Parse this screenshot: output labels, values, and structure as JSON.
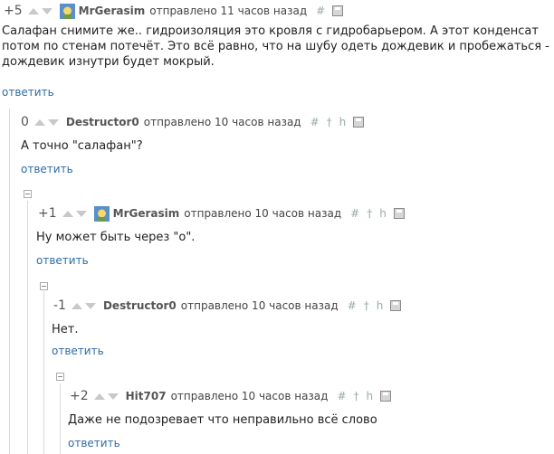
{
  "icons": {
    "hash": "#",
    "pin": "†",
    "tree": "h"
  },
  "comments": [
    {
      "rating": "+5",
      "author": "MrGerasim",
      "meta": "отправлено 11 часов назад",
      "text": "Салафан снимите же.. гидроизоляция это кровля с гидробарьером. А этот конденсат потом по стенам потечёт. Это всё равно, что на шубу одеть дождевик и пробежаться - дождевик изнутри будет мокрый.",
      "reply": "ответить"
    },
    {
      "rating": "0",
      "author": "Destructor0",
      "meta": "отправлено 10 часов назад",
      "text": "А точно \"салафан\"?",
      "reply": "ответить"
    },
    {
      "rating": "+1",
      "author": "MrGerasim",
      "meta": "отправлено 10 часов назад",
      "text": "Ну может быть через \"о\".",
      "reply": "ответить"
    },
    {
      "rating": "-1",
      "author": "Destructor0",
      "meta": "отправлено 10 часов назад",
      "text": "Нет.",
      "reply": "ответить"
    },
    {
      "rating": "+2",
      "author": "Hit707",
      "meta": "отправлено 10 часов назад",
      "text": "Даже не подозревает что неправильно всё слово",
      "reply": "ответить"
    }
  ]
}
